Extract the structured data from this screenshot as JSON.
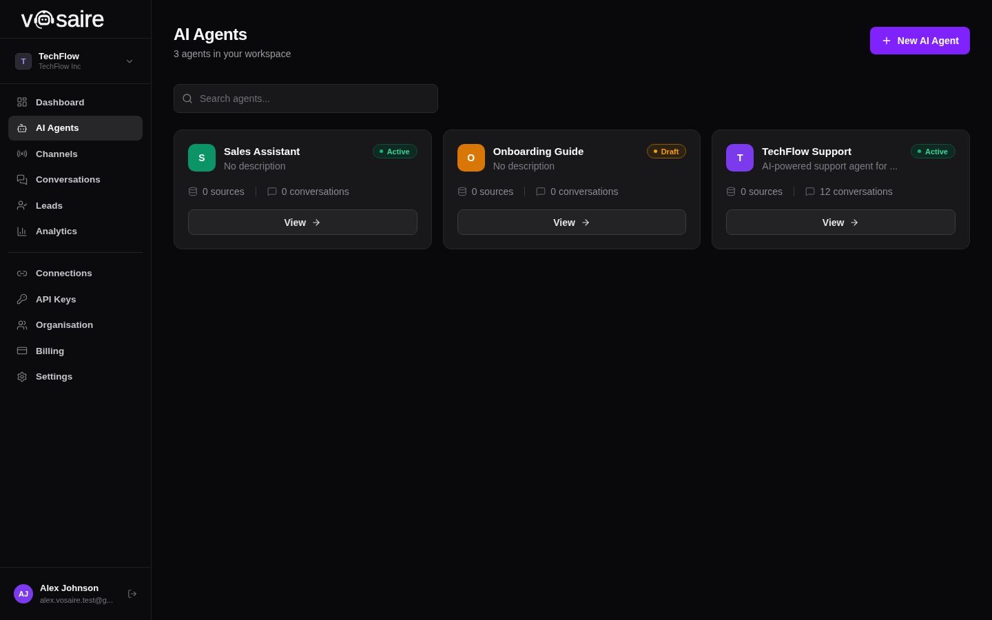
{
  "sidebar": {
    "logo": {
      "prefix": "v",
      "suffix": "saire"
    },
    "workspace": {
      "initial": "T",
      "name": "TechFlow",
      "organization": "TechFlow Inc"
    },
    "nav_groups": [
      {
        "items": [
          {
            "label": "Dashboard",
            "selected": false
          },
          {
            "label": "AI Agents",
            "selected": true
          },
          {
            "label": "Channels",
            "selected": false
          },
          {
            "label": "Conversations",
            "selected": false
          },
          {
            "label": "Leads",
            "selected": false
          },
          {
            "label": "Analytics",
            "selected": false
          }
        ]
      },
      {
        "items": [
          {
            "label": "Connections",
            "selected": false
          },
          {
            "label": "API Keys",
            "selected": false
          },
          {
            "label": "Organisation",
            "selected": false
          },
          {
            "label": "Billing",
            "selected": false
          },
          {
            "label": "Settings",
            "selected": false
          }
        ]
      }
    ],
    "user": {
      "initials": "AJ",
      "name": "Alex Johnson",
      "email": "alex.vosaire.test@g..."
    }
  },
  "header": {
    "title": "AI Agents",
    "subtitle": "3 agents in your workspace",
    "new_button": "New AI Agent"
  },
  "search": {
    "placeholder": "Search agents..."
  },
  "agents": [
    {
      "initial": "S",
      "color": "#0b9466",
      "name": "Sales Assistant",
      "description": "No description",
      "status": {
        "kind": "active",
        "label": "Active"
      },
      "sources": "0 sources",
      "conversations": "0 conversations",
      "action": "View"
    },
    {
      "initial": "O",
      "color": "#d97706",
      "name": "Onboarding Guide",
      "description": "No description",
      "status": {
        "kind": "draft",
        "label": "Draft"
      },
      "sources": "0 sources",
      "conversations": "0 conversations",
      "action": "View"
    },
    {
      "initial": "T",
      "color": "#7c3aed",
      "name": "TechFlow Support",
      "description": "AI-powered support agent for ...",
      "status": {
        "kind": "active",
        "label": "Active"
      },
      "sources": "0 sources",
      "conversations": "12 conversations",
      "action": "View"
    }
  ]
}
